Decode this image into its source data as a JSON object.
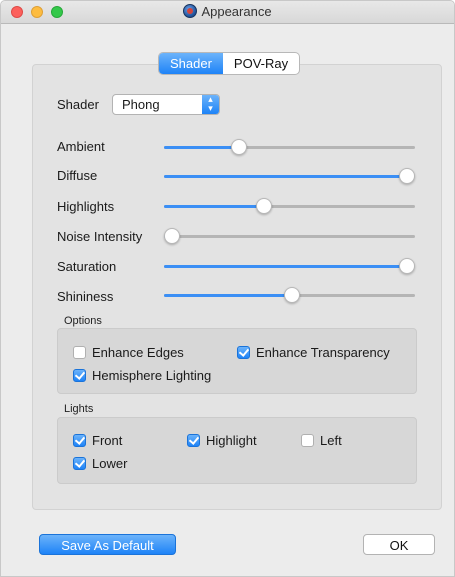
{
  "window": {
    "title": "Appearance"
  },
  "tabs": [
    {
      "label": "Shader",
      "active": true
    },
    {
      "label": "POV-Ray",
      "active": false
    }
  ],
  "shader": {
    "label": "Shader",
    "selected": "Phong"
  },
  "sliders": [
    {
      "label": "Ambient",
      "value": 0.3
    },
    {
      "label": "Diffuse",
      "value": 0.97
    },
    {
      "label": "Highlights",
      "value": 0.4
    },
    {
      "label": "Noise Intensity",
      "value": 0.03
    },
    {
      "label": "Saturation",
      "value": 0.97
    },
    {
      "label": "Shininess",
      "value": 0.51
    }
  ],
  "options": {
    "title": "Options",
    "items": [
      {
        "label": "Enhance Edges",
        "checked": false
      },
      {
        "label": "Enhance Transparency",
        "checked": true
      },
      {
        "label": "Hemisphere Lighting",
        "checked": true
      }
    ]
  },
  "lights": {
    "title": "Lights",
    "items": [
      {
        "label": "Front",
        "checked": true
      },
      {
        "label": "Highlight",
        "checked": true
      },
      {
        "label": "Left",
        "checked": false
      },
      {
        "label": "Lower",
        "checked": true
      }
    ]
  },
  "buttons": {
    "save_default": "Save As Default",
    "ok": "OK"
  },
  "colors": {
    "accent": "#1e83f7",
    "window_bg": "#ececec"
  }
}
